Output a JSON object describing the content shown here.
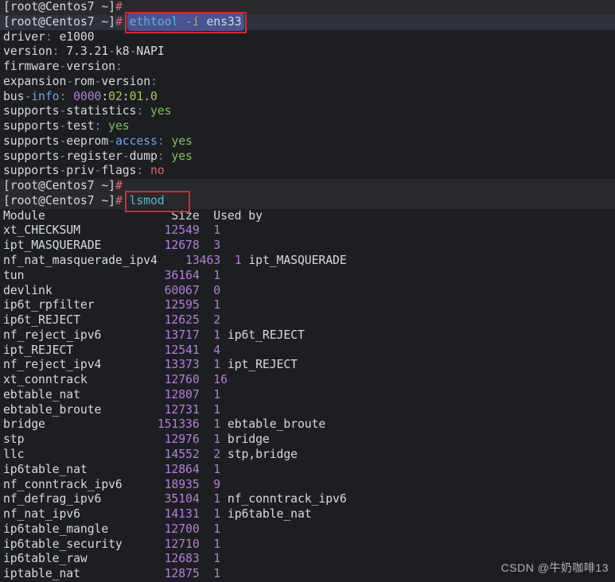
{
  "colors": {
    "bg": "#1d1e21",
    "hl": "#28292d",
    "hl2": "#2f3140",
    "sel": "#4a5391",
    "box": "#e62129",
    "fg": "#d6d9dd",
    "dim": "#7e8691",
    "blue": "#6ba3f2",
    "cyan": "#58b7cf",
    "orange": "#d19a66",
    "purple": "#b47ed9",
    "green": "#7ec25d",
    "lime": "#a9c548",
    "red": "#e0636f",
    "wm": "#b3b5b7"
  },
  "terminal": {
    "prompt": "[root@Centos7 ~]",
    "prompt_symbol": "#",
    "commands": [
      "ethtool -i ens33",
      "lsmod"
    ],
    "lines": [
      {
        "hl": "hl",
        "segs": [
          {
            "t": "[root@Centos7 ~]"
          },
          {
            "t": "#",
            "c": "red"
          }
        ]
      },
      {
        "hl": "hl2",
        "box": [
          3,
          7
        ],
        "segs": [
          {
            "t": "[root@Centos7 ~]"
          },
          {
            "t": "#",
            "c": "red"
          },
          {
            "t": " "
          },
          {
            "t": "ethtool",
            "c": "cyan",
            "sel": true
          },
          {
            "t": " ",
            "sel": true
          },
          {
            "t": "-i",
            "c": "orange",
            "sel": true
          },
          {
            "t": " ",
            "sel": true
          },
          {
            "t": "ens33",
            "sel": true
          }
        ]
      },
      {
        "segs": [
          {
            "t": "driver"
          },
          {
            "t": ":",
            "c": "dim"
          },
          {
            "t": " e1000"
          }
        ]
      },
      {
        "segs": [
          {
            "t": "version"
          },
          {
            "t": ":",
            "c": "dim"
          },
          {
            "t": " 7.3.21"
          },
          {
            "t": "-",
            "c": "dim"
          },
          {
            "t": "k8"
          },
          {
            "t": "-",
            "c": "dim"
          },
          {
            "t": "NAPI"
          }
        ]
      },
      {
        "segs": [
          {
            "t": "firmware"
          },
          {
            "t": "-",
            "c": "dim"
          },
          {
            "t": "version"
          },
          {
            "t": ":",
            "c": "dim"
          }
        ]
      },
      {
        "segs": [
          {
            "t": "expansion"
          },
          {
            "t": "-",
            "c": "dim"
          },
          {
            "t": "rom"
          },
          {
            "t": "-",
            "c": "dim"
          },
          {
            "t": "version"
          },
          {
            "t": ":",
            "c": "dim"
          }
        ]
      },
      {
        "segs": [
          {
            "t": "bus"
          },
          {
            "t": "-",
            "c": "dim"
          },
          {
            "t": "info",
            "c": "blue"
          },
          {
            "t": ":",
            "c": "dim"
          },
          {
            "t": " "
          },
          {
            "t": "0000",
            "c": "purple"
          },
          {
            "t": ":"
          },
          {
            "t": "02",
            "c": "lime"
          },
          {
            "t": ":"
          },
          {
            "t": "01.0",
            "c": "lime"
          }
        ]
      },
      {
        "segs": [
          {
            "t": "supports"
          },
          {
            "t": "-",
            "c": "dim"
          },
          {
            "t": "statistics"
          },
          {
            "t": ":",
            "c": "dim"
          },
          {
            "t": " "
          },
          {
            "t": "yes",
            "c": "green"
          }
        ]
      },
      {
        "segs": [
          {
            "t": "supports"
          },
          {
            "t": "-",
            "c": "dim"
          },
          {
            "t": "test"
          },
          {
            "t": ":",
            "c": "dim"
          },
          {
            "t": " "
          },
          {
            "t": "yes",
            "c": "green"
          }
        ]
      },
      {
        "segs": [
          {
            "t": "supports"
          },
          {
            "t": "-",
            "c": "dim"
          },
          {
            "t": "eeprom"
          },
          {
            "t": "-",
            "c": "dim"
          },
          {
            "t": "access",
            "c": "blue"
          },
          {
            "t": ":",
            "c": "dim"
          },
          {
            "t": " "
          },
          {
            "t": "yes",
            "c": "green"
          }
        ]
      },
      {
        "segs": [
          {
            "t": "supports"
          },
          {
            "t": "-",
            "c": "dim"
          },
          {
            "t": "register"
          },
          {
            "t": "-",
            "c": "dim"
          },
          {
            "t": "dump"
          },
          {
            "t": ":",
            "c": "dim"
          },
          {
            "t": " "
          },
          {
            "t": "yes",
            "c": "green"
          }
        ]
      },
      {
        "segs": [
          {
            "t": "supports"
          },
          {
            "t": "-",
            "c": "dim"
          },
          {
            "t": "priv"
          },
          {
            "t": "-",
            "c": "dim"
          },
          {
            "t": "flags"
          },
          {
            "t": ":",
            "c": "dim"
          },
          {
            "t": " "
          },
          {
            "t": "no",
            "c": "red"
          }
        ]
      },
      {
        "hl": "hl",
        "segs": [
          {
            "t": "[root@Centos7 ~]"
          },
          {
            "t": "#",
            "c": "red"
          }
        ]
      },
      {
        "hl": "hl",
        "box": [
          3,
          4
        ],
        "segs": [
          {
            "t": "[root@Centos7 ~]"
          },
          {
            "t": "#",
            "c": "red"
          },
          {
            "t": " "
          },
          {
            "t": "lsmod",
            "c": "cyan"
          },
          {
            "t": "   "
          }
        ]
      }
    ],
    "lsmod": {
      "header": {
        "module": "Module",
        "size": "Size",
        "used_by": "Used by"
      },
      "rows": [
        {
          "name": "xt_CHECKSUM",
          "size": "12549",
          "used": "1",
          "by": ""
        },
        {
          "name": "ipt_MASQUERADE",
          "size": "12678",
          "used": "3",
          "by": ""
        },
        {
          "name": "nf_nat_masquerade_ipv4",
          "size": "13463",
          "used": "1",
          "by": "ipt_MASQUERADE"
        },
        {
          "name": "tun",
          "size": "36164",
          "used": "1",
          "by": ""
        },
        {
          "name": "devlink",
          "size": "60067",
          "used": "0",
          "by": ""
        },
        {
          "name": "ip6t_rpfilter",
          "size": "12595",
          "used": "1",
          "by": ""
        },
        {
          "name": "ip6t_REJECT",
          "size": "12625",
          "used": "2",
          "by": ""
        },
        {
          "name": "nf_reject_ipv6",
          "size": "13717",
          "used": "1",
          "by": "ip6t_REJECT"
        },
        {
          "name": "ipt_REJECT",
          "size": "12541",
          "used": "4",
          "by": ""
        },
        {
          "name": "nf_reject_ipv4",
          "size": "13373",
          "used": "1",
          "by": "ipt_REJECT"
        },
        {
          "name": "xt_conntrack",
          "size": "12760",
          "used": "16",
          "by": ""
        },
        {
          "name": "ebtable_nat",
          "size": "12807",
          "used": "1",
          "by": ""
        },
        {
          "name": "ebtable_broute",
          "size": "12731",
          "used": "1",
          "by": ""
        },
        {
          "name": "bridge",
          "size": "151336",
          "used": "1",
          "by": "ebtable_broute"
        },
        {
          "name": "stp",
          "size": "12976",
          "used": "1",
          "by": "bridge"
        },
        {
          "name": "llc",
          "size": "14552",
          "used": "2",
          "by": "stp,bridge"
        },
        {
          "name": "ip6table_nat",
          "size": "12864",
          "used": "1",
          "by": ""
        },
        {
          "name": "nf_conntrack_ipv6",
          "size": "18935",
          "used": "9",
          "by": ""
        },
        {
          "name": "nf_defrag_ipv6",
          "size": "35104",
          "used": "1",
          "by": "nf_conntrack_ipv6"
        },
        {
          "name": "nf_nat_ipv6",
          "size": "14131",
          "used": "1",
          "by": "ip6table_nat"
        },
        {
          "name": "ip6table_mangle",
          "size": "12700",
          "used": "1",
          "by": ""
        },
        {
          "name": "ip6table_security",
          "size": "12710",
          "used": "1",
          "by": ""
        },
        {
          "name": "ip6table_raw",
          "size": "12683",
          "used": "1",
          "by": ""
        },
        {
          "name": "iptable_nat",
          "size": "12875",
          "used": "1",
          "by": ""
        }
      ]
    }
  },
  "watermark": "CSDN @牛奶咖啡13"
}
